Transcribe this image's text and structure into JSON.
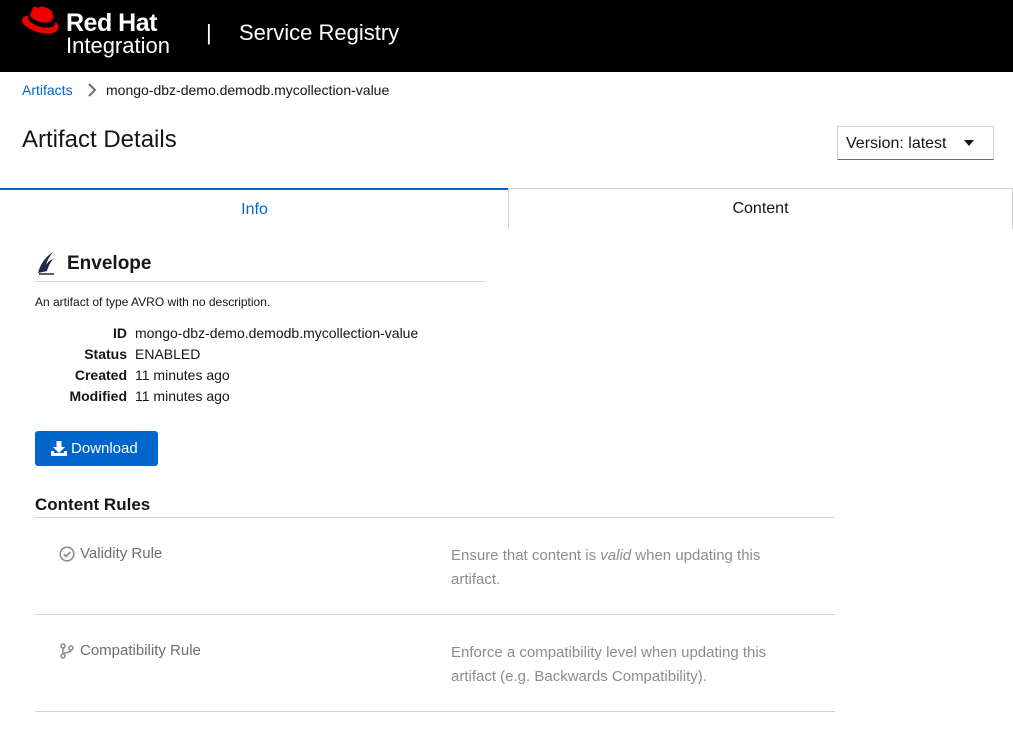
{
  "masthead": {
    "brand_line1": "Red Hat",
    "brand_line2": "Integration",
    "separator": "|",
    "app_title": "Service Registry",
    "logo_color": "#ee0000"
  },
  "breadcrumb": {
    "link": "Artifacts",
    "current": "mongo-dbz-demo.demodb.mycollection-value"
  },
  "header": {
    "title": "Artifact Details",
    "version_label": "Version: latest"
  },
  "tabs": [
    {
      "label": "Info",
      "active": true
    },
    {
      "label": "Content",
      "active": false
    }
  ],
  "artifact": {
    "name": "Envelope",
    "icon": "avro-feather-icon",
    "description": "An artifact of type AVRO with no description.",
    "meta": [
      {
        "key": "ID",
        "value": "mongo-dbz-demo.demodb.mycollection-value"
      },
      {
        "key": "Status",
        "value": "ENABLED"
      },
      {
        "key": "Created",
        "value": "11 minutes ago"
      },
      {
        "key": "Modified",
        "value": "11 minutes ago"
      }
    ],
    "download_label": "Download"
  },
  "rules": {
    "title": "Content Rules",
    "items": [
      {
        "name": "Validity Rule",
        "icon": "check-circle-icon",
        "desc_before": "Ensure that content is ",
        "desc_em": "valid",
        "desc_after": " when updating this artifact."
      },
      {
        "name": "Compatibility Rule",
        "icon": "code-branch-icon",
        "desc_before": "Enforce a compatibility level when updating this artifact (e.g. Backwards Compatibility).",
        "desc_em": "",
        "desc_after": ""
      }
    ]
  },
  "colors": {
    "accent": "#0066cc",
    "masthead_bg": "#000000"
  }
}
